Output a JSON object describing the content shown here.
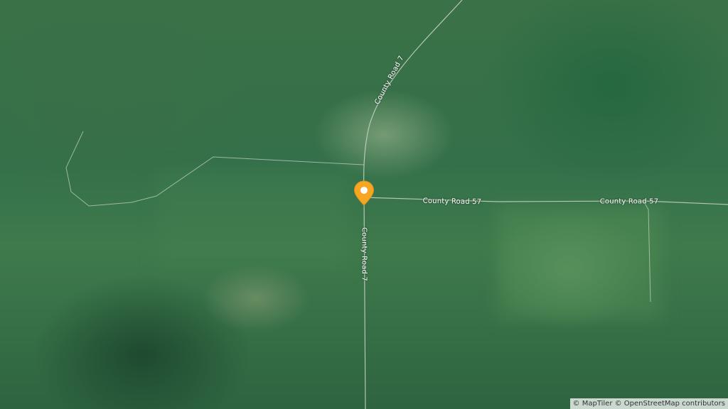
{
  "map": {
    "marker": {
      "name": "location-pin-icon",
      "color": "#F5A623"
    },
    "roads": {
      "county_road_7": "County Road 7",
      "county_road_57": "County Road 57"
    },
    "attribution": "© MapTiler © OpenStreetMap contributors"
  }
}
